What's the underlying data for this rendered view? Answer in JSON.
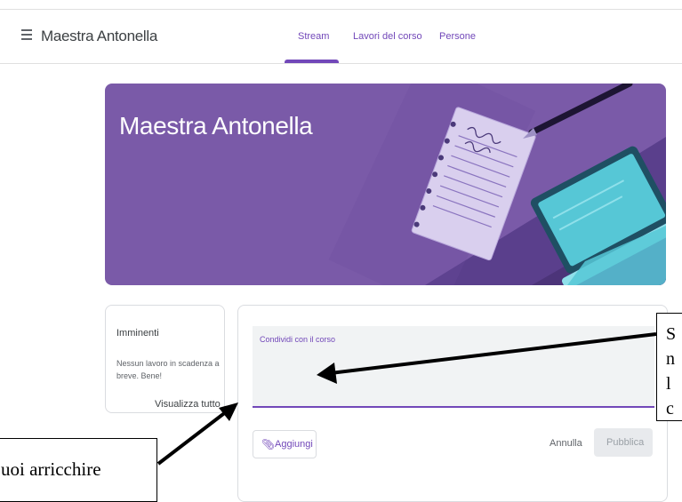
{
  "header": {
    "title": "Maestra Antonella",
    "tabs": [
      {
        "label": "Stream",
        "active": true
      },
      {
        "label": "Lavori del corso",
        "active": false
      },
      {
        "label": "Persone",
        "active": false
      }
    ]
  },
  "banner": {
    "title": "Maestra Antonella"
  },
  "upcoming": {
    "title": "Imminenti",
    "text": "Nessun lavoro in scadenza a breve. Bene!",
    "view_all": "Visualizza tutto"
  },
  "post": {
    "label": "Condividi con il corso",
    "add_label": "Aggiungi",
    "cancel_label": "Annulla",
    "publish_label": "Pubblica"
  },
  "annotations": {
    "left_text": "uoi arricchire",
    "right_fragments": [
      "S",
      "n",
      "l",
      "c"
    ]
  },
  "colors": {
    "accent": "#7248b9",
    "banner": "#7a5aa8",
    "banner_dark": "#5a3f8c",
    "laptop": "#56c7d6"
  }
}
